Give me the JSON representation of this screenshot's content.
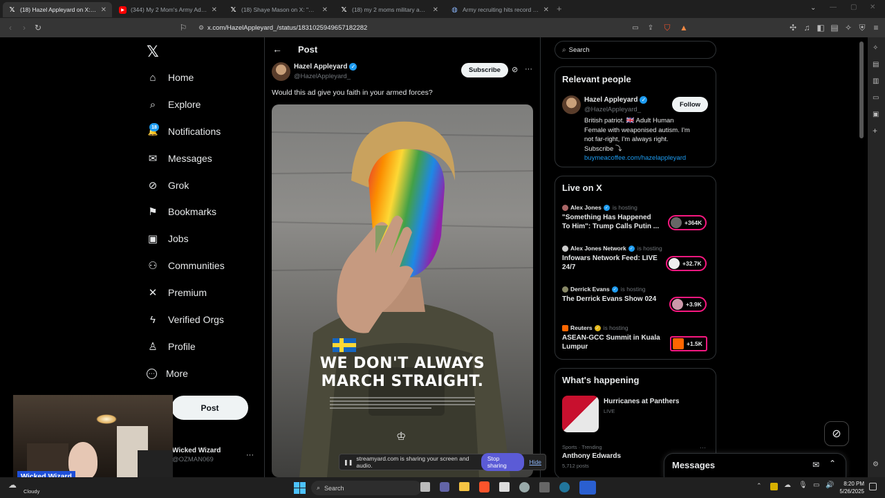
{
  "browser": {
    "tabs": [
      {
        "icon": "x-logo-icon",
        "label": "(18) Hazel Appleyard on X: \"W...",
        "active": true
      },
      {
        "icon": "youtube-icon",
        "label": "(344) My 2 Mom's Army Ad - D...",
        "active": false
      },
      {
        "icon": "x-logo-icon",
        "label": "(18) Shaye Mason on X: \"Remembe...",
        "active": false
      },
      {
        "icon": "x-logo-icon",
        "label": "(18) my 2 moms military add - Sea...",
        "active": false
      },
      {
        "icon": "globe-icon",
        "label": "Army recruiting hits record highs a...",
        "active": false
      }
    ],
    "url": "x.com/HazelAppleyard_/status/1831025949657182282"
  },
  "sidebar": {
    "items": [
      {
        "name": "home",
        "icon": "home-icon",
        "glyph": "⌂",
        "label": "Home"
      },
      {
        "name": "explore",
        "icon": "search-icon",
        "glyph": "⌕",
        "label": "Explore"
      },
      {
        "name": "notifications",
        "icon": "bell-icon",
        "glyph": "🔔",
        "label": "Notifications"
      },
      {
        "name": "messages",
        "icon": "envelope-icon",
        "glyph": "✉",
        "label": "Messages"
      },
      {
        "name": "grok",
        "icon": "grok-icon",
        "glyph": "⊘",
        "label": "Grok"
      },
      {
        "name": "bookmarks",
        "icon": "bookmark-icon",
        "glyph": "⚑",
        "label": "Bookmarks"
      },
      {
        "name": "jobs",
        "icon": "briefcase-icon",
        "glyph": "▣",
        "label": "Jobs"
      },
      {
        "name": "communities",
        "icon": "people-icon",
        "glyph": "⚇",
        "label": "Communities"
      },
      {
        "name": "premium",
        "icon": "x-logo-icon",
        "glyph": "✕",
        "label": "Premium"
      },
      {
        "name": "verified-orgs",
        "icon": "lightning-icon",
        "glyph": "ϟ",
        "label": "Verified Orgs"
      },
      {
        "name": "profile",
        "icon": "person-icon",
        "glyph": "♙",
        "label": "Profile"
      },
      {
        "name": "more",
        "icon": "more-circle-icon",
        "glyph": "⋯",
        "label": "More"
      }
    ],
    "notifications_badge": "18",
    "post_label": "Post",
    "account": {
      "name": "Wicked Wizard",
      "handle": "@OZMAN069"
    }
  },
  "main": {
    "header_title": "Post",
    "author": {
      "name": "Hazel Appleyard",
      "handle": "@HazelAppleyard_"
    },
    "subscribe_label": "Subscribe",
    "tweet_text": "Would this ad give you faith in your armed forces?",
    "image": {
      "headline_line1": "WE DON'T ALWAYS",
      "headline_line2": "MARCH STRAIGHT."
    }
  },
  "right": {
    "search_placeholder": "Search",
    "relevant": {
      "title": "Relevant people",
      "name": "Hazel Appleyard",
      "handle": "@HazelAppleyard_",
      "follow_label": "Follow",
      "bio_lines": [
        "British patriot. 🇬🇧 Adult Human",
        "Female with weaponised autism. I'm",
        "not far-right, I'm always right.",
        "Subscribe ⤵"
      ],
      "link": "buymeacoffee.com/hazelappleyard"
    },
    "live": {
      "title": "Live on X",
      "items": [
        {
          "user": "Alex Jones",
          "status": "is hosting",
          "title_lines": [
            "\"Something Has Happened",
            "To Him\": Trump Calls Putin ..."
          ],
          "count": "+364K"
        },
        {
          "user": "Alex Jones Network",
          "status": "is hosting",
          "title_lines": [
            "Infowars Network Feed: LIVE",
            "24/7"
          ],
          "count": "+32.7K"
        },
        {
          "user": "Derrick Evans",
          "status": "is hosting",
          "title_lines": [
            "The Derrick Evans Show 024"
          ],
          "count": "+3.9K"
        },
        {
          "user": "Reuters",
          "status": "is hosting",
          "title_lines": [
            "ASEAN-GCC Summit in Kuala",
            "Lumpur"
          ],
          "count": "+1.5K"
        }
      ]
    },
    "happening": {
      "title": "What's happening",
      "event_title": "Hurricanes at Panthers",
      "event_status": "LIVE",
      "trend_context": "Sports · Trending",
      "trend_name": "Anthony Edwards",
      "trend_posts": "5,712 posts"
    },
    "messages_drawer": "Messages"
  },
  "overlay": {
    "share_text": "streamyard.com is sharing your screen and audio.",
    "stop_label": "Stop sharing",
    "hide_label": "Hide",
    "webcam_name": "Wicked Wizard"
  },
  "taskbar": {
    "weather": "Cloudy",
    "search_label": "Search",
    "time": "8:20 PM",
    "date": "5/26/2025"
  },
  "colors": {
    "accent": "#1d9bf0",
    "live": "#f91880",
    "link": "#1d9bf0"
  }
}
